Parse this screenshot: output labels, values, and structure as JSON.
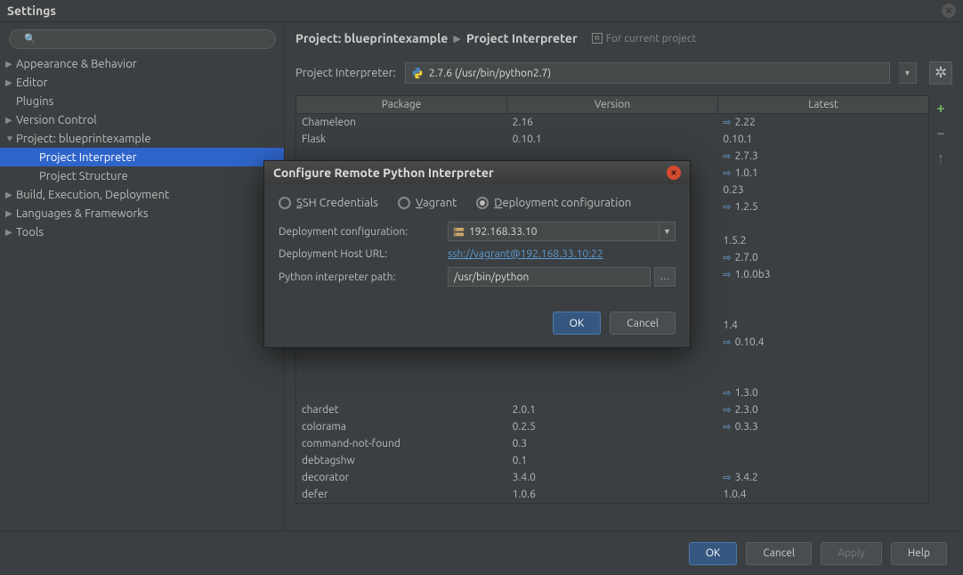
{
  "window": {
    "title": "Settings"
  },
  "search": {
    "placeholder": ""
  },
  "sidebar": {
    "items": [
      {
        "label": "Appearance & Behavior",
        "level": 0,
        "arrow": "▶",
        "selected": false
      },
      {
        "label": "Editor",
        "level": 0,
        "arrow": "▶",
        "selected": false
      },
      {
        "label": "Plugins",
        "level": 0,
        "arrow": "",
        "selected": false
      },
      {
        "label": "Version Control",
        "level": 0,
        "arrow": "▶",
        "selected": false
      },
      {
        "label": "Project: blueprintexample",
        "level": 0,
        "arrow": "▼",
        "selected": false
      },
      {
        "label": "Project Interpreter",
        "level": 1,
        "arrow": "",
        "selected": true
      },
      {
        "label": "Project Structure",
        "level": 1,
        "arrow": "",
        "selected": false
      },
      {
        "label": "Build, Execution, Deployment",
        "level": 0,
        "arrow": "▶",
        "selected": false
      },
      {
        "label": "Languages & Frameworks",
        "level": 0,
        "arrow": "▶",
        "selected": false
      },
      {
        "label": "Tools",
        "level": 0,
        "arrow": "▶",
        "selected": false
      }
    ]
  },
  "breadcrumb": {
    "part1": "Project: blueprintexample",
    "part2": "Project Interpreter",
    "hint": "For current project"
  },
  "interpreter": {
    "label": "Project Interpreter:",
    "value": "2.7.6 (/usr/bin/python2.7)"
  },
  "table": {
    "headers": [
      "Package",
      "Version",
      "Latest"
    ],
    "rows": [
      {
        "pkg": "Chameleon",
        "ver": "2.16",
        "latest": "2.22",
        "up": true
      },
      {
        "pkg": "Flask",
        "ver": "0.10.1",
        "latest": "0.10.1",
        "up": false
      },
      {
        "pkg": "",
        "ver": "",
        "latest": "2.7.3",
        "up": true
      },
      {
        "pkg": "",
        "ver": "",
        "latest": "1.0.1",
        "up": true
      },
      {
        "pkg": "",
        "ver": "",
        "latest": "0.23",
        "up": false
      },
      {
        "pkg": "",
        "ver": "",
        "latest": "1.2.5",
        "up": true
      },
      {
        "pkg": "",
        "ver": "",
        "latest": "",
        "up": false
      },
      {
        "pkg": "",
        "ver": "",
        "latest": "1.5.2",
        "up": false
      },
      {
        "pkg": "",
        "ver": "",
        "latest": "2.7.0",
        "up": true
      },
      {
        "pkg": "",
        "ver": "",
        "latest": "1.0.0b3",
        "up": true
      },
      {
        "pkg": "",
        "ver": "",
        "latest": "",
        "up": false
      },
      {
        "pkg": "",
        "ver": "",
        "latest": "",
        "up": false
      },
      {
        "pkg": "",
        "ver": "",
        "latest": "1.4",
        "up": false
      },
      {
        "pkg": "",
        "ver": "",
        "latest": "0.10.4",
        "up": true
      },
      {
        "pkg": "",
        "ver": "",
        "latest": "",
        "up": false
      },
      {
        "pkg": "",
        "ver": "",
        "latest": "",
        "up": false
      },
      {
        "pkg": "",
        "ver": "",
        "latest": "1.3.0",
        "up": true
      },
      {
        "pkg": "chardet",
        "ver": "2.0.1",
        "latest": "2.3.0",
        "up": true
      },
      {
        "pkg": "colorama",
        "ver": "0.2.5",
        "latest": "0.3.3",
        "up": true
      },
      {
        "pkg": "command-not-found",
        "ver": "0.3",
        "latest": "",
        "up": false
      },
      {
        "pkg": "debtagshw",
        "ver": "0.1",
        "latest": "",
        "up": false
      },
      {
        "pkg": "decorator",
        "ver": "3.4.0",
        "latest": "3.4.2",
        "up": true
      },
      {
        "pkg": "defer",
        "ver": "1.0.6",
        "latest": "1.0.4",
        "up": false
      }
    ]
  },
  "tools": {
    "add": "+",
    "remove": "−",
    "up": "↑"
  },
  "footer": {
    "ok": "OK",
    "cancel": "Cancel",
    "apply": "Apply",
    "help": "Help"
  },
  "modal": {
    "title": "Configure Remote Python Interpreter",
    "radios": {
      "ssh": {
        "prefix": "S",
        "rest": "SH Credentials"
      },
      "vagrant": {
        "prefix": "V",
        "rest": "agrant"
      },
      "deploy": {
        "prefix": "D",
        "rest": "eployment configuration"
      }
    },
    "deploy_cfg_label": "Deployment configuration:",
    "deploy_cfg_value": "192.168.33.10",
    "host_label": "Deployment Host URL:",
    "host_value": "ssh://vagrant@192.168.33.10:22",
    "path_label": "Python interpreter path:",
    "path_value": "/usr/bin/python",
    "ok": "OK",
    "cancel": "Cancel"
  }
}
